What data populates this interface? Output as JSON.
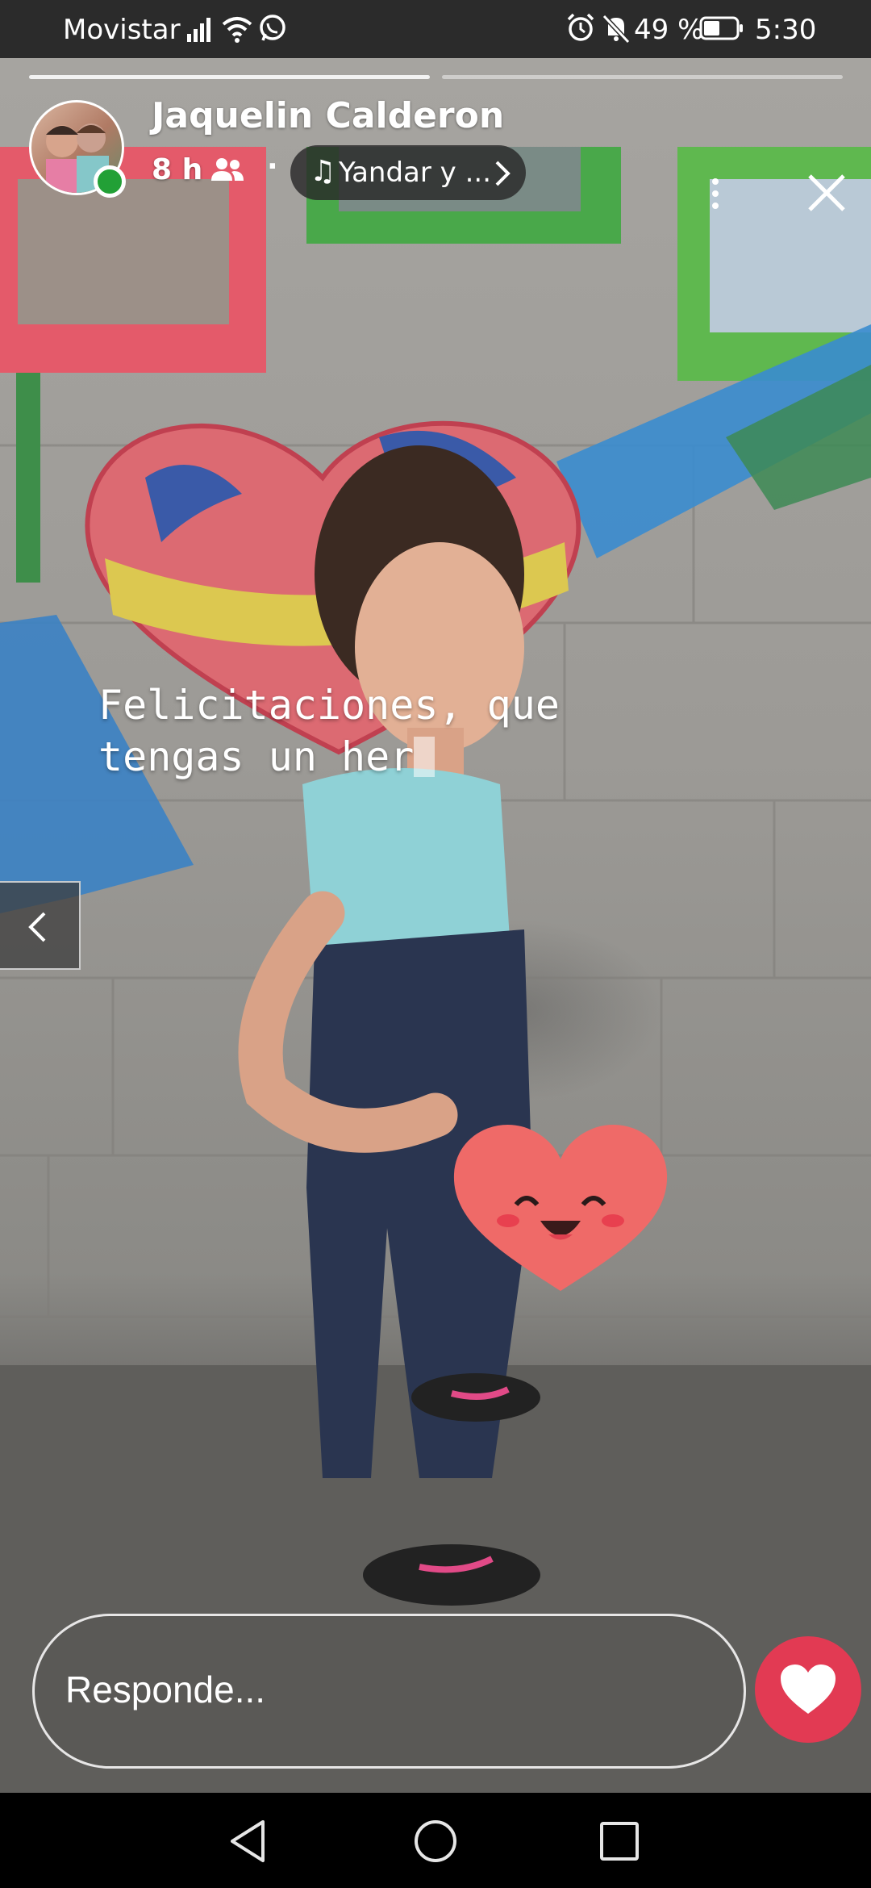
{
  "status_bar": {
    "carrier": "Movistar",
    "battery_percent": "49 %",
    "time": "5:30",
    "icons": [
      "signal-icon",
      "wifi-icon",
      "whatsapp-icon",
      "alarm-icon",
      "mute-icon",
      "battery-icon"
    ]
  },
  "story": {
    "progress": [
      1.0,
      0.0
    ],
    "user_name": "Jaquelin Calderon",
    "time_ago": "8 h",
    "audience_icon": "friends-icon",
    "separator": "·",
    "music_note": "♫",
    "song": "Yandar y ...",
    "caption_lines": [
      "Felicitaciones, que",
      "tengas un her"
    ],
    "sticker": "smiling-heart-sticker"
  },
  "reply": {
    "placeholder": "Responde..."
  },
  "colors": {
    "like_button": "#e23a53",
    "online_indicator": "#22a036",
    "status_bar_bg": "#2b2b2b"
  }
}
